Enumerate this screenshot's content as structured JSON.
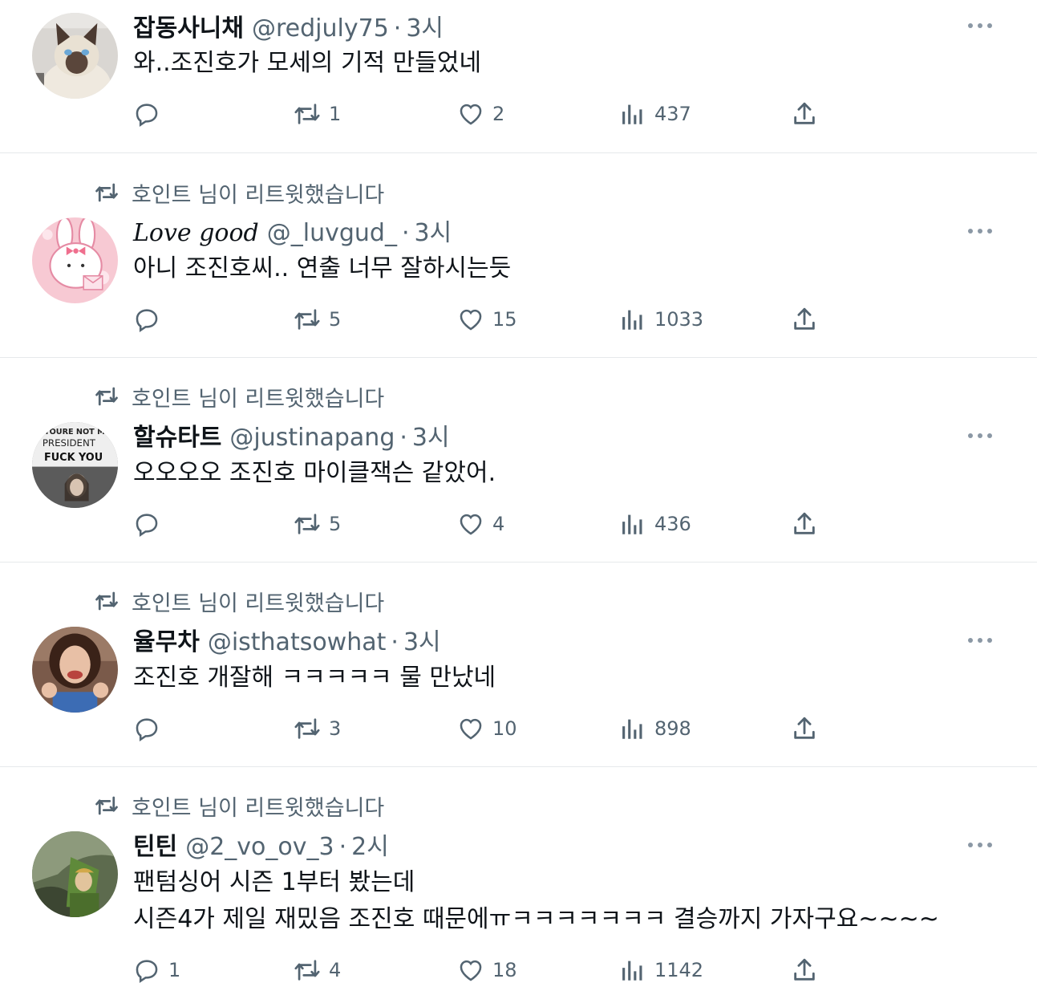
{
  "tweets": [
    {
      "retweeted_by": "",
      "avatar_icon": "siamese-cat-avatar",
      "name": "잡동사니채",
      "handle": "@redjuly75",
      "time": "3시",
      "text": "와..조진호가 모세의 기적 만들었네",
      "replies": "",
      "retweets": "1",
      "likes": "2",
      "views": "437"
    },
    {
      "retweeted_by": "호인트 님이 리트윗했습니다",
      "avatar_icon": "pink-bunny-character-avatar",
      "name": "Love good",
      "handle": "@_luvgud_",
      "time": "3시",
      "text": "아니 조진호씨.. 연출 너무 잘하시는듯",
      "replies": "",
      "retweets": "5",
      "likes": "15",
      "views": "1033"
    },
    {
      "retweeted_by": "호인트 님이 리트윗했습니다",
      "avatar_icon": "protest-sign-photo-avatar",
      "avatar_sign_line1": "YOURE NOT MY",
      "avatar_sign_line2": "PRESIDENT",
      "avatar_sign_line3": "FUCK YOU",
      "name": "할슈타트",
      "handle": "@justinapang",
      "time": "3시",
      "text": "오오오오 조진호 마이클잭슨 같았어.",
      "replies": "",
      "retweets": "5",
      "likes": "4",
      "views": "436"
    },
    {
      "retweeted_by": "호인트 님이 리트윗했습니다",
      "avatar_icon": "smiling-woman-thumbs-up-avatar",
      "name": "율무차",
      "handle": "@isthatsowhat",
      "time": "3시",
      "text": "조진호 개잘해 ㅋㅋㅋㅋㅋ 물 만났네",
      "replies": "",
      "retweets": "3",
      "likes": "10",
      "views": "898"
    },
    {
      "retweeted_by": "호인트 님이 리트윗했습니다",
      "avatar_icon": "green-hooded-game-character-avatar",
      "name": "틴틴",
      "handle": "@2_vo_ov_3",
      "time": "2시",
      "text": "팬텀싱어 시즌 1부터 봤는데\n시즌4가 제일 재밌음 조진호 때문에ㅠㅋㅋㅋㅋㅋㅋㅋ 결승까지 가자구요~~~~",
      "replies": "1",
      "retweets": "4",
      "likes": "18",
      "views": "1142"
    }
  ],
  "separator": "·",
  "colors": {
    "text_primary": "#0f1419",
    "text_secondary": "#536471",
    "divider": "#e6e9eb",
    "background": "#ffffff"
  }
}
